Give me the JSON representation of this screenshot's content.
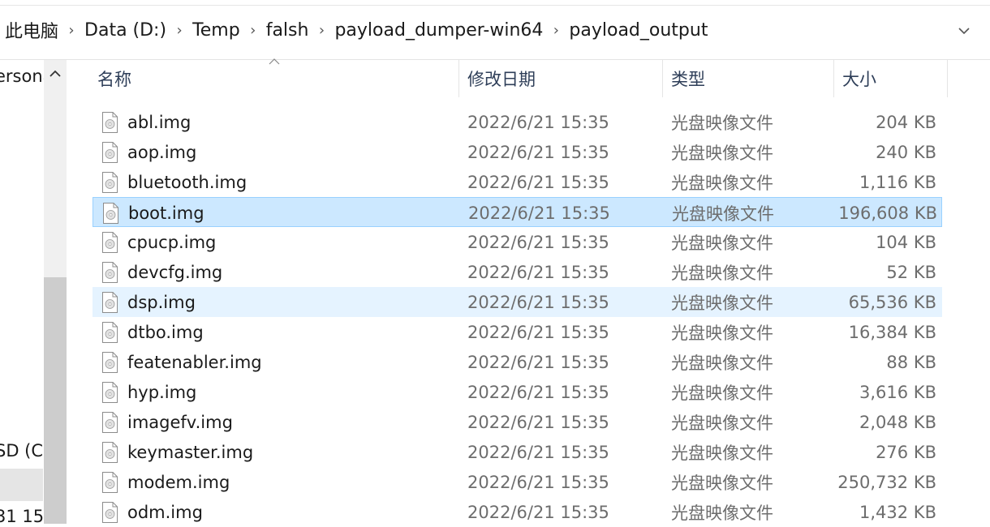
{
  "breadcrumb": {
    "items": [
      "此电脑",
      "Data (D:)",
      "Temp",
      "falsh",
      "payload_dumper-win64",
      "payload_output"
    ],
    "separator": "›",
    "dropdown_icon": "chevron-down-icon"
  },
  "nav": {
    "items": [
      "ersona",
      "SD (C:",
      "31 15"
    ],
    "scroll_up_icon": "chevron-up-icon"
  },
  "columns": {
    "name": "名称",
    "date": "修改日期",
    "type": "类型",
    "size": "大小"
  },
  "files": [
    {
      "name": "abl.img",
      "date": "2022/6/21 15:35",
      "type": "光盘映像文件",
      "size": "204 KB",
      "state": "normal"
    },
    {
      "name": "aop.img",
      "date": "2022/6/21 15:35",
      "type": "光盘映像文件",
      "size": "240 KB",
      "state": "normal"
    },
    {
      "name": "bluetooth.img",
      "date": "2022/6/21 15:35",
      "type": "光盘映像文件",
      "size": "1,116 KB",
      "state": "normal"
    },
    {
      "name": "boot.img",
      "date": "2022/6/21 15:35",
      "type": "光盘映像文件",
      "size": "196,608 KB",
      "state": "selected"
    },
    {
      "name": "cpucp.img",
      "date": "2022/6/21 15:35",
      "type": "光盘映像文件",
      "size": "104 KB",
      "state": "normal"
    },
    {
      "name": "devcfg.img",
      "date": "2022/6/21 15:35",
      "type": "光盘映像文件",
      "size": "52 KB",
      "state": "normal"
    },
    {
      "name": "dsp.img",
      "date": "2022/6/21 15:35",
      "type": "光盘映像文件",
      "size": "65,536 KB",
      "state": "hover"
    },
    {
      "name": "dtbo.img",
      "date": "2022/6/21 15:35",
      "type": "光盘映像文件",
      "size": "16,384 KB",
      "state": "normal"
    },
    {
      "name": "featenabler.img",
      "date": "2022/6/21 15:35",
      "type": "光盘映像文件",
      "size": "88 KB",
      "state": "normal"
    },
    {
      "name": "hyp.img",
      "date": "2022/6/21 15:35",
      "type": "光盘映像文件",
      "size": "3,616 KB",
      "state": "normal"
    },
    {
      "name": "imagefv.img",
      "date": "2022/6/21 15:35",
      "type": "光盘映像文件",
      "size": "2,048 KB",
      "state": "normal"
    },
    {
      "name": "keymaster.img",
      "date": "2022/6/21 15:35",
      "type": "光盘映像文件",
      "size": "276 KB",
      "state": "normal"
    },
    {
      "name": "modem.img",
      "date": "2022/6/21 15:35",
      "type": "光盘映像文件",
      "size": "250,732 KB",
      "state": "normal"
    },
    {
      "name": "odm.img",
      "date": "2022/6/21 15:35",
      "type": "光盘映像文件",
      "size": "1,432 KB",
      "state": "normal"
    }
  ],
  "file_icon": "disc-image-file-icon",
  "colors": {
    "selected_bg": "#cce8ff",
    "selected_border": "#99d1ff",
    "hover_bg": "#e5f3ff",
    "header_text": "#2e3e58"
  }
}
